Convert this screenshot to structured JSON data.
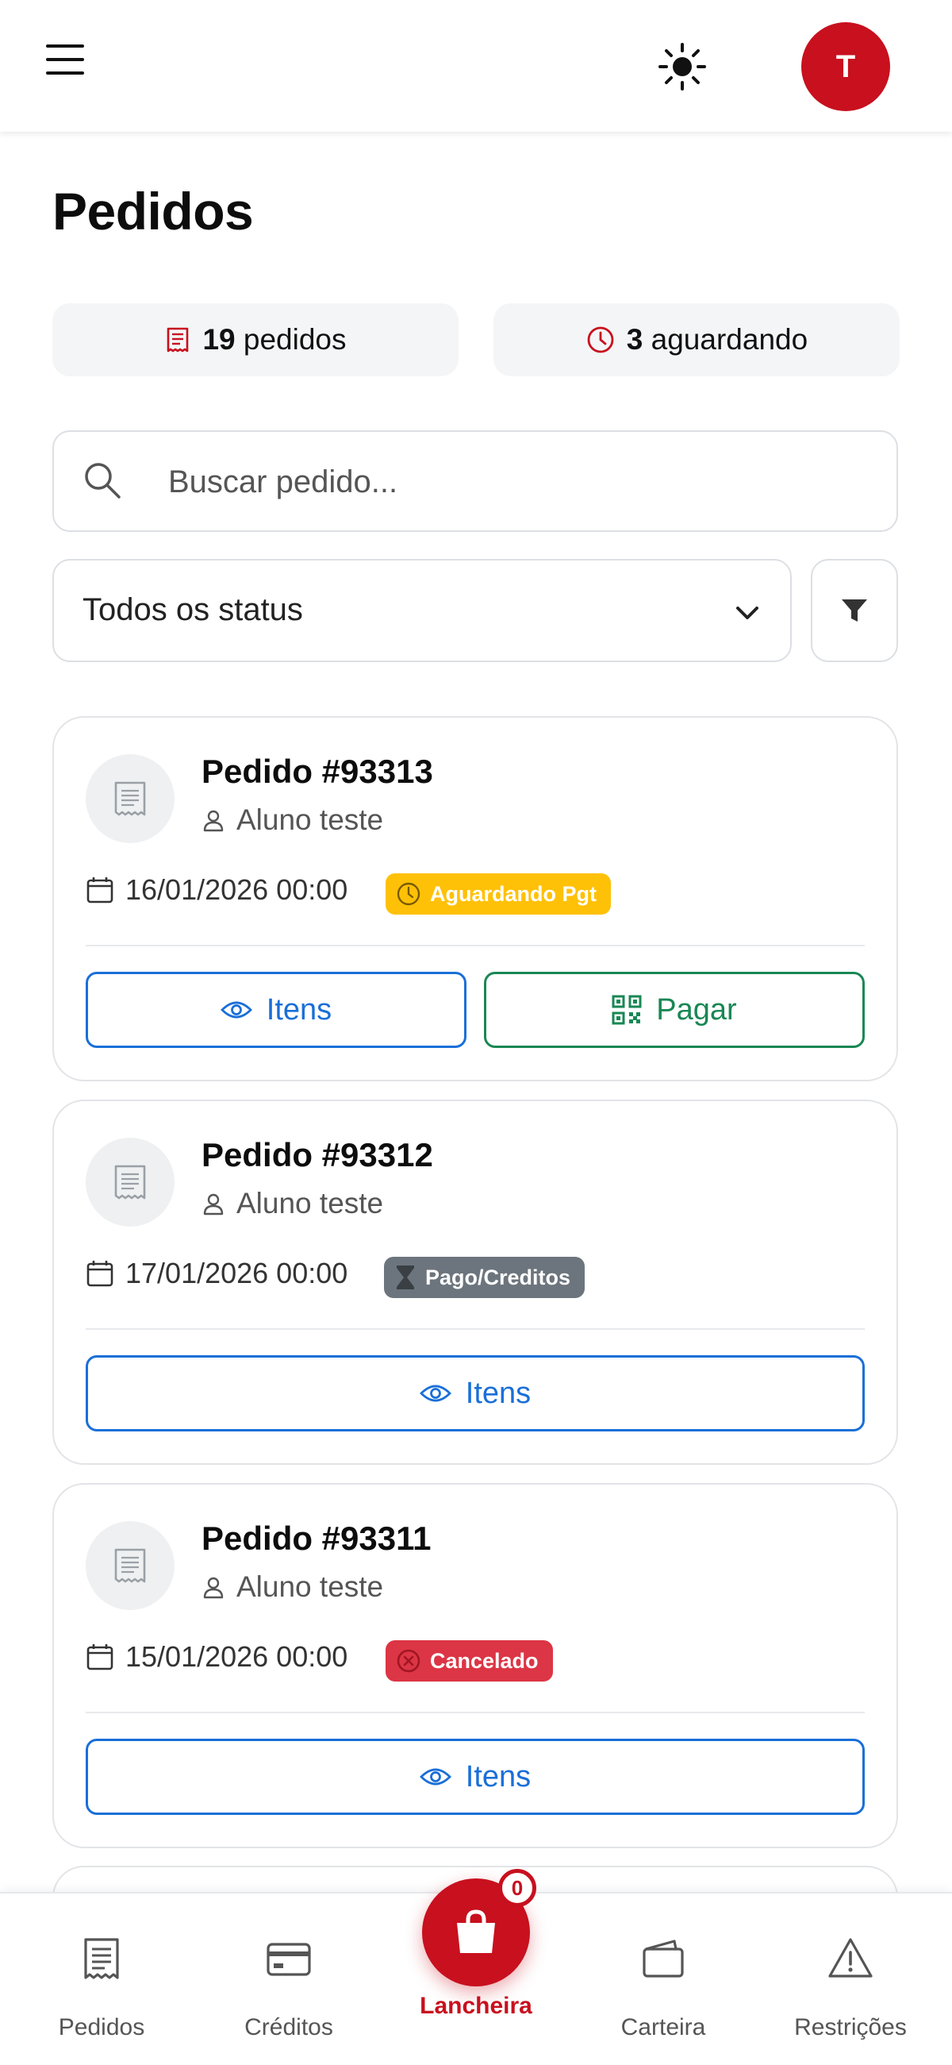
{
  "header": {
    "avatar_initial": "T"
  },
  "page": {
    "title": "Pedidos"
  },
  "stats": {
    "orders_count": "19",
    "orders_label": "pedidos",
    "waiting_count": "3",
    "waiting_label": "aguardando"
  },
  "search": {
    "placeholder": "Buscar pedido..."
  },
  "status_filter": {
    "selected": "Todos os status"
  },
  "orders": [
    {
      "title": "Pedido #93313",
      "student": "Aluno teste",
      "date": "16/01/2026 00:00",
      "status": "Aguardando Pgt",
      "status_color": "#ffc107",
      "items_label": "Itens",
      "pay_label": "Pagar"
    },
    {
      "title": "Pedido #93312",
      "student": "Aluno teste",
      "date": "17/01/2026 00:00",
      "status": "Pago/Creditos",
      "status_color": "#6c757d",
      "items_label": "Itens"
    },
    {
      "title": "Pedido #93311",
      "student": "Aluno teste",
      "date": "15/01/2026 00:00",
      "status": "Cancelado",
      "status_color": "#dc3545",
      "items_label": "Itens"
    }
  ],
  "bottom_nav": {
    "items": [
      {
        "label": "Pedidos",
        "icon": "receipt-icon"
      },
      {
        "label": "Créditos",
        "icon": "credit-card-icon"
      },
      {
        "label": "Lancheira",
        "icon": "shopping-bag-icon"
      },
      {
        "label": "Carteira",
        "icon": "wallet-icon"
      },
      {
        "label": "Restrições",
        "icon": "warning-icon"
      }
    ],
    "cart_count": "0"
  },
  "colors": {
    "brand": "#c8101e",
    "primary": "#1a6fd8",
    "success": "#198754"
  }
}
